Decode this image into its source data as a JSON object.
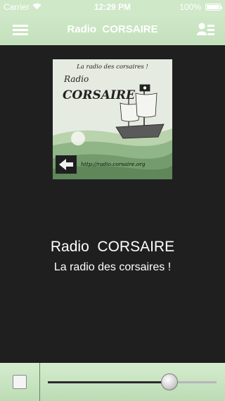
{
  "statusbar": {
    "carrier": "Carrier",
    "time": "12:29 PM",
    "battery": "100%"
  },
  "navbar": {
    "title": "Radio  CORSAIRE",
    "menu_icon": "hamburger-menu-icon",
    "contact_icon": "contact-list-icon"
  },
  "artwork": {
    "headline": "La radio des corsaires !",
    "word1": "Radio",
    "word2": "CORSAIRE",
    "url": "http://radio.corsaire.org"
  },
  "station": {
    "name": "Radio  CORSAIRE",
    "tagline": "La radio des corsaires !"
  },
  "player": {
    "stop_icon": "stop-icon",
    "volume": 0.72
  },
  "colors": {
    "accent": "#c8e4c0",
    "background": "#1f1f1f"
  }
}
